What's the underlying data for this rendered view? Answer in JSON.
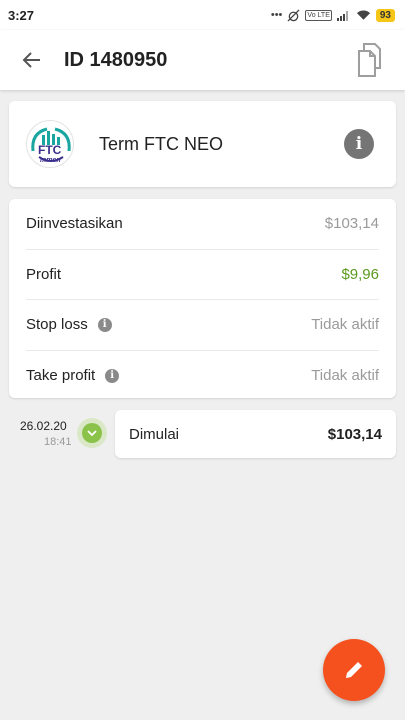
{
  "status_bar": {
    "time": "3:27",
    "battery": "93",
    "network": "4G",
    "lte": "Vo LTE"
  },
  "header": {
    "title": "ID 1480950",
    "back_icon": "arrow-back-icon",
    "copy_icon": "copy-icon"
  },
  "product": {
    "name": "Term FTC NEO",
    "logo_text": "FTC",
    "logo_subtext": "mmen"
  },
  "details": [
    {
      "label": "Diinvestasikan",
      "value": "$103,14"
    },
    {
      "label": "Profit",
      "value": "$9,96"
    },
    {
      "label": "Stop loss",
      "value": "Tidak aktif"
    },
    {
      "label": "Take profit",
      "value": "Tidak aktif"
    }
  ],
  "timeline": {
    "date": "26.02.20",
    "time": "18:41",
    "event_label": "Dimulai",
    "event_amount": "$103,14"
  },
  "colors": {
    "profit": "#5a9a1e",
    "fab": "#f4511e",
    "marker": "#8bc34a"
  }
}
